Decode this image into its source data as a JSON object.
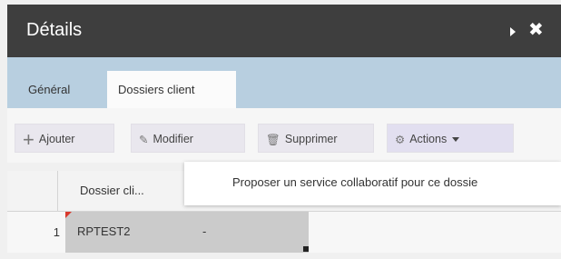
{
  "panel": {
    "title": "Détails",
    "expand_icon": "arrow-right-icon",
    "close_icon": "close-icon",
    "close_glyph": "✖"
  },
  "tabs": [
    {
      "label": "Général",
      "active": false
    },
    {
      "label": "Dossiers client",
      "active": true
    }
  ],
  "toolbar": {
    "add_label": "Ajouter",
    "edit_label": "Modifier",
    "delete_label": "Supprimer",
    "actions_label": "Actions",
    "add_glyph": "+",
    "edit_glyph": "✎",
    "delete_glyph": "🗑",
    "actions_glyph": "⚙"
  },
  "dropdown": {
    "items": [
      "Proposer un service collaboratif pour ce dossie"
    ]
  },
  "grid": {
    "columns": [
      "Dossier cli..."
    ],
    "rows": [
      {
        "num": "1",
        "name": "RPTEST2",
        "value": "-"
      }
    ]
  }
}
